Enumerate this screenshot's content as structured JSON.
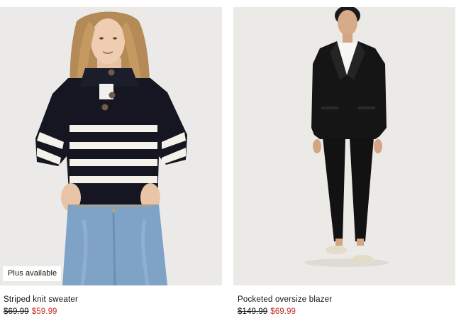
{
  "products": [
    {
      "name": "Striped knit sweater",
      "original_price": "$69.99",
      "sale_price": "$59.99",
      "badge": "Plus available"
    },
    {
      "name": "Pocketed oversize blazer",
      "original_price": "$149.99",
      "sale_price": "$69.99"
    }
  ],
  "colors": {
    "sale_price": "#c6302b",
    "photo_background": "#ececeb"
  }
}
